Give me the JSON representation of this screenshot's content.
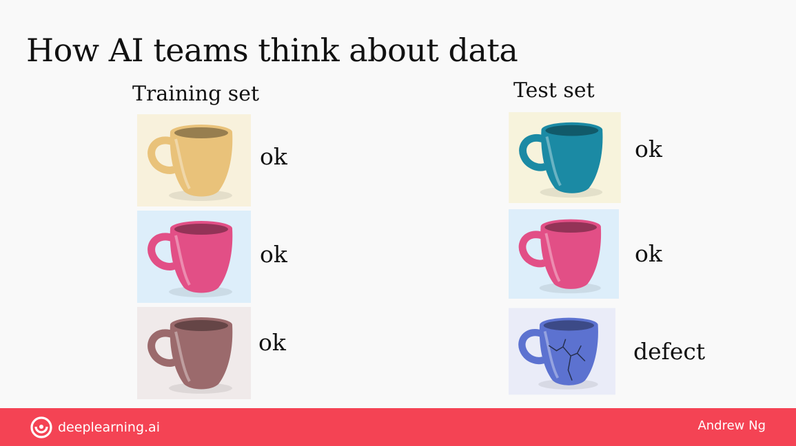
{
  "slide": {
    "title": "How AI teams think about data",
    "training_heading": "Training set",
    "test_heading": "Test set",
    "training_items": [
      {
        "label": "ok",
        "mug_color": "#e9c27a",
        "background": "#f8f1dc"
      },
      {
        "label": "ok",
        "mug_color": "#e24f86",
        "background": "#ddeefa"
      },
      {
        "label": "ok",
        "mug_color": "#9b6a6c",
        "background": "#f0eaea"
      }
    ],
    "test_items": [
      {
        "label": "ok",
        "mug_color": "#1b8aa4",
        "background": "#f7f3dc"
      },
      {
        "label": "ok",
        "mug_color": "#e24f86",
        "background": "#ddeefa"
      },
      {
        "label": "defect",
        "mug_color": "#5c72d0",
        "background": "#eaecf8"
      }
    ]
  },
  "footer": {
    "brand": "deeplearning.ai",
    "author": "Andrew Ng",
    "color": "#f44354"
  }
}
